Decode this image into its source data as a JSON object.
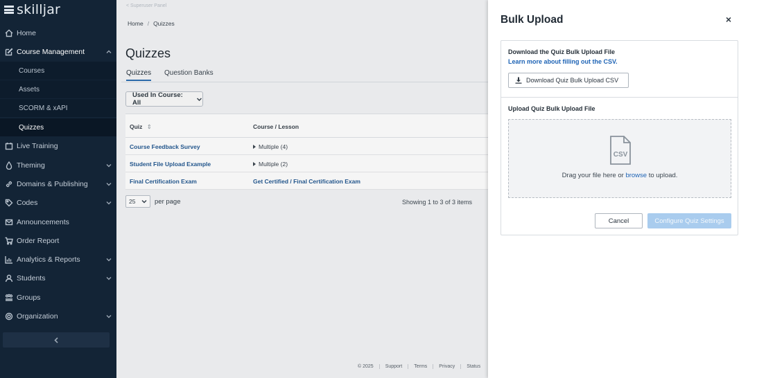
{
  "app": {
    "logo_text": "skilljar"
  },
  "sidebar": {
    "items": [
      {
        "label": "Home",
        "icon": "home-icon"
      },
      {
        "label": "Course Management",
        "icon": "edit-icon",
        "expanded": true
      },
      {
        "label": "Live Training",
        "icon": "calendar-icon"
      },
      {
        "label": "Theming",
        "icon": "droplet-icon"
      },
      {
        "label": "Domains & Publishing",
        "icon": "link-icon"
      },
      {
        "label": "Codes",
        "icon": "tag-icon"
      },
      {
        "label": "Announcements",
        "icon": "mail-icon"
      },
      {
        "label": "Order Report",
        "icon": "cart-icon"
      },
      {
        "label": "Analytics & Reports",
        "icon": "chart-icon"
      },
      {
        "label": "Students",
        "icon": "user-icon"
      },
      {
        "label": "Groups",
        "icon": "group-icon"
      },
      {
        "label": "Organization",
        "icon": "gear-icon"
      }
    ],
    "subitems": [
      {
        "label": "Courses"
      },
      {
        "label": "Assets"
      },
      {
        "label": "SCORM & xAPI"
      },
      {
        "label": "Quizzes",
        "current": true
      }
    ]
  },
  "main": {
    "superuser_label": "< Superuser Panel",
    "breadcrumb": {
      "home": "Home",
      "separator": "/",
      "current": "Quizzes"
    },
    "title": "Quizzes",
    "tabs": [
      {
        "label": "Quizzes",
        "active": true
      },
      {
        "label": "Question Banks"
      }
    ],
    "filter_label": "Used In Course: All",
    "table": {
      "columns": [
        "Quiz",
        "Course / Lesson"
      ],
      "sort_indicator": "⇕",
      "rows": [
        {
          "quiz": "Course Feedback Survey",
          "course": "Multiple (4)"
        },
        {
          "quiz": "Student File Upload Example",
          "course": "Multiple (2)"
        },
        {
          "quiz": "Final Certification Exam",
          "course": "Get Certified / Final Certification Exam"
        }
      ]
    },
    "per_page_value": "25",
    "per_page_label": "per page",
    "showing": "Showing 1 to 3 of 3 items",
    "footer": [
      "© 2025",
      "Support",
      "Terms",
      "Privacy",
      "Status"
    ]
  },
  "drawer": {
    "title": "Bulk Upload",
    "close": "×",
    "download_title": "Download the Quiz Bulk Upload File",
    "learn_more": "Learn more about filling out the CSV.",
    "download_button": "Download Quiz Bulk Upload CSV",
    "upload_title": "Upload Quiz Bulk Upload File",
    "drop_prefix": "Drag your file here or ",
    "drop_browse": "browse",
    "drop_suffix": " to upload.",
    "csv_icon_label": "CSV",
    "cancel": "Cancel",
    "configure": "Configure Quiz Settings"
  },
  "colors": {
    "sidebar_bg": "#132436",
    "link": "#1d63b5",
    "primary_disabled": "#a9ccee"
  }
}
